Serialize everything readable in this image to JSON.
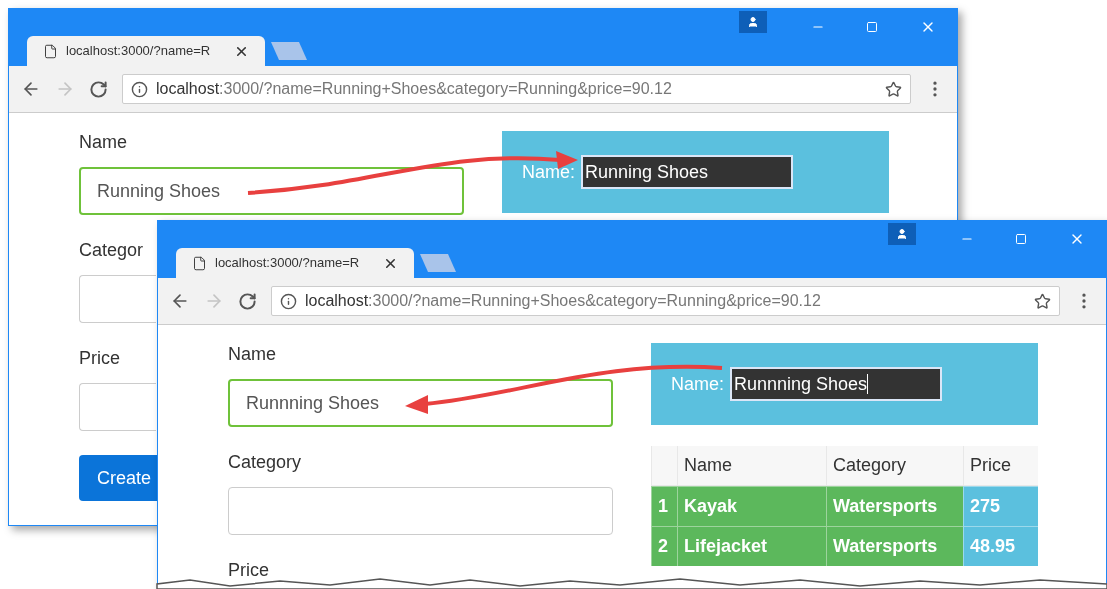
{
  "windows": [
    {
      "tab_title": "localhost:3000/?name=R",
      "url": {
        "host": "localhost",
        "path": ":3000/?name=Running+Shoes&category=Running&price=90.12"
      },
      "form": {
        "fields": [
          {
            "label": "Name",
            "kind": "input",
            "value": "Running Shoes",
            "valid": true
          },
          {
            "label": "Categor",
            "kind": "input",
            "valid": false
          },
          {
            "label": "Price",
            "kind": "input",
            "valid": false
          }
        ],
        "button": "Create"
      },
      "panel": {
        "label": "Name:",
        "value": "Running Shoes",
        "caret": false
      }
    },
    {
      "tab_title": "localhost:3000/?name=R",
      "url": {
        "host": "localhost",
        "path": ":3000/?name=Running+Shoes&category=Running&price=90.12"
      },
      "form": {
        "fields": [
          {
            "label": "Name",
            "kind": "input",
            "value": "Runnning Shoes",
            "valid": true
          },
          {
            "label": "Category",
            "kind": "input",
            "valid": false
          },
          {
            "label": "Price",
            "kind": "label"
          }
        ]
      },
      "panel": {
        "label": "Name:",
        "value": "Runnning Shoes",
        "caret": true
      },
      "table": {
        "columns": [
          {
            "color": "#5cb85c"
          },
          {
            "label": "Name",
            "color": "#5cb85c"
          },
          {
            "label": "Category",
            "color": "#5cb85c"
          },
          {
            "label": "Price",
            "color": "#5bc0de"
          }
        ],
        "rows": [
          [
            "1",
            "Kayak",
            "Watersports",
            "275"
          ],
          [
            "2",
            "Lifejacket",
            "Watersports",
            "48.95"
          ]
        ]
      }
    }
  ]
}
